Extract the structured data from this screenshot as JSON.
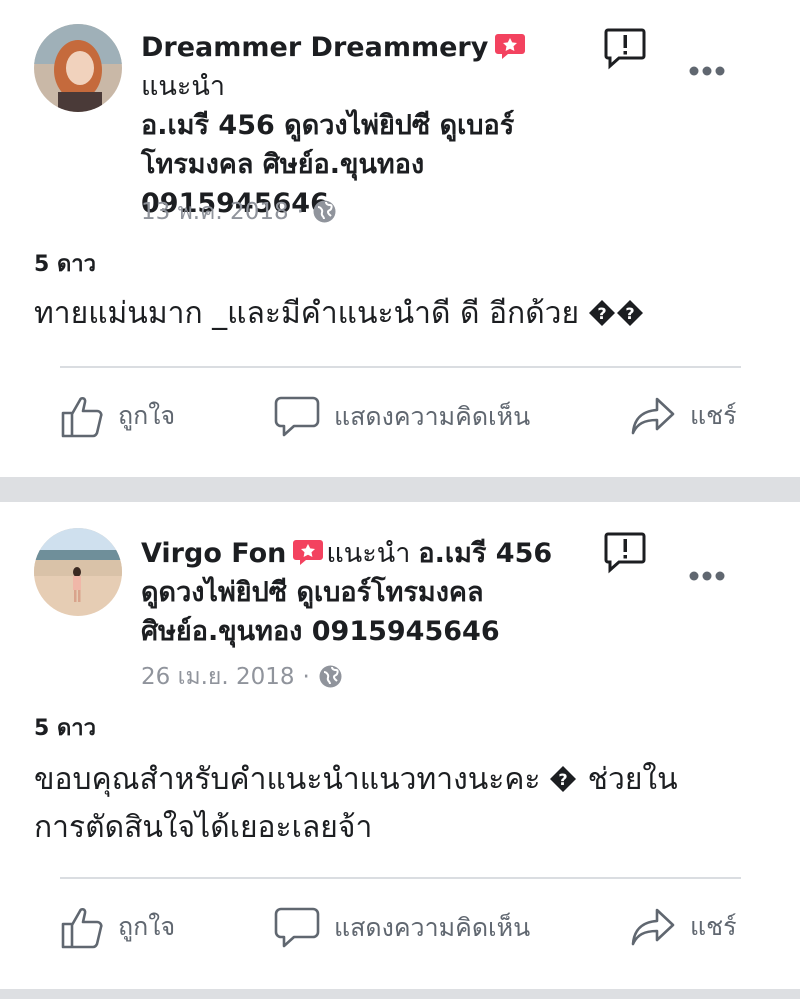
{
  "posts": [
    {
      "author": "Dreammer Dreammery",
      "recommend_label": "แนะนำ",
      "header_lines": [
        "อ.เมรี 456 ดูดวงไพ่ยิปซี ดูเบอร์",
        "โทรมงคล ศิษย์อ.ขุนทอง",
        "0915945646"
      ],
      "date": "13 พ.ค. 2018",
      "separator": "·",
      "rating": "5 ดาว",
      "body_lines": [
        "ทายแม่นมาก _และมีคำแนะนำดี ดี อีกด้วย"
      ],
      "body_trailing_glyphs": 2,
      "actions": {
        "like": "ถูกใจ",
        "comment": "แสดงความคิดเห็น",
        "share": "แชร์"
      }
    },
    {
      "author": "Virgo Fon",
      "recommend_label": "แนะนำ",
      "header_inline": "อ.เมรี 456",
      "header_lines": [
        "ดูดวงไพ่ยิปซี ดูเบอร์โทรมงคล",
        "ศิษย์อ.ขุนทอง 0915945646"
      ],
      "date": "26 เม.ย. 2018",
      "separator": "·",
      "rating": "5 ดาว",
      "body_lines": [
        "ขอบคุณสำหรับคำแนะนำแนวทางนะคะ",
        "ช่วยใน",
        "การตัดสินใจได้เยอะเลยจ้า"
      ],
      "actions": {
        "like": "ถูกใจ",
        "comment": "แสดงความคิดเห็น",
        "share": "แชร์"
      }
    }
  ],
  "colors": {
    "badge": "#f3425f",
    "muted": "#90949c",
    "action": "#606770",
    "separator": "#dddfe2"
  },
  "icons": [
    "recommend-badge-icon",
    "report-icon",
    "more-icon",
    "globe-icon",
    "like-icon",
    "comment-icon",
    "share-icon",
    "question-mark-icon"
  ]
}
